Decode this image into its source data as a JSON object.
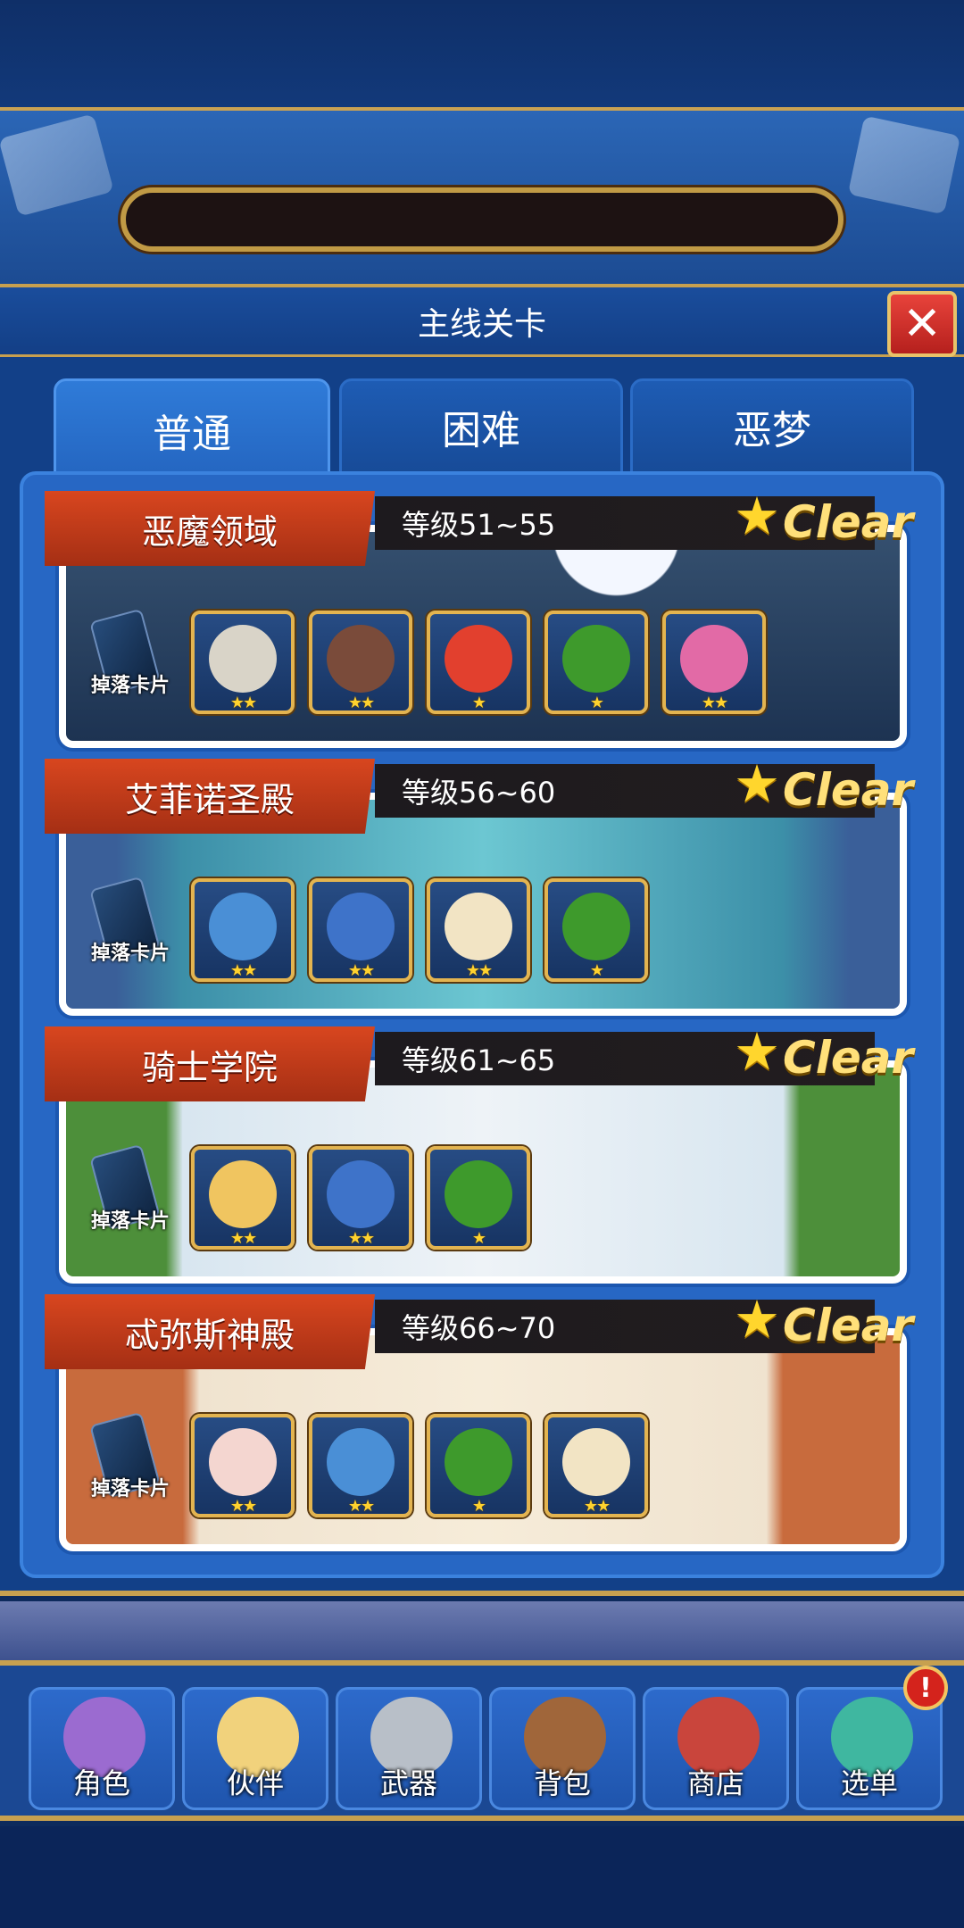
{
  "window": {
    "title": "主线关卡",
    "close_symbol": "✕"
  },
  "tabs": [
    {
      "label": "普通",
      "active": true
    },
    {
      "label": "困难",
      "active": false
    },
    {
      "label": "恶梦",
      "active": false
    }
  ],
  "drop_label": "掉落卡片",
  "clear_label": "Clear",
  "stages": [
    {
      "name": "恶魔领域",
      "level": "等级51~55",
      "enemies": [
        {
          "icon": "skeleton-shield-icon",
          "stars": "★★",
          "color": "#d9d4c8"
        },
        {
          "icon": "hooded-monk-icon",
          "stars": "★★",
          "color": "#7a4b3a"
        },
        {
          "icon": "red-cat-imp-icon",
          "stars": "★",
          "color": "#e2402e"
        },
        {
          "icon": "green-hood-icon",
          "stars": "★",
          "color": "#3e9a2c"
        },
        {
          "icon": "pink-succubus-icon",
          "stars": "★★",
          "color": "#e26aa6"
        }
      ]
    },
    {
      "name": "艾菲诺圣殿",
      "level": "等级56~60",
      "enemies": [
        {
          "icon": "blue-cap-boy-icon",
          "stars": "★★",
          "color": "#4a8fd6"
        },
        {
          "icon": "blue-knight-icon",
          "stars": "★★",
          "color": "#3e73c9"
        },
        {
          "icon": "unicorn-icon",
          "stars": "★★",
          "color": "#f2e4c4"
        },
        {
          "icon": "green-hood-icon",
          "stars": "★",
          "color": "#3e9a2c"
        }
      ]
    },
    {
      "name": "骑士学院",
      "level": "等级61~65",
      "enemies": [
        {
          "icon": "blonde-girl-icon",
          "stars": "★★",
          "color": "#f0c560"
        },
        {
          "icon": "blue-knight-icon",
          "stars": "★★",
          "color": "#3e73c9"
        },
        {
          "icon": "green-hood-icon",
          "stars": "★",
          "color": "#3e9a2c"
        }
      ]
    },
    {
      "name": "忒弥斯神殿",
      "level": "等级66~70",
      "enemies": [
        {
          "icon": "owl-icon",
          "stars": "★★",
          "color": "#f4d6d0"
        },
        {
          "icon": "blue-cap-boy-icon",
          "stars": "★★",
          "color": "#4a8fd6"
        },
        {
          "icon": "green-hood-icon",
          "stars": "★",
          "color": "#3e9a2c"
        },
        {
          "icon": "unicorn-icon",
          "stars": "★★",
          "color": "#f2e4c4"
        }
      ]
    }
  ],
  "nav": [
    {
      "label": "角色",
      "icon": "purple-hair-girl-icon",
      "color": "#9b6bd0"
    },
    {
      "label": "伙伴",
      "icon": "fairy-icon",
      "color": "#f1d27c"
    },
    {
      "label": "武器",
      "icon": "sword-icon",
      "color": "#b8bfc8"
    },
    {
      "label": "背包",
      "icon": "backpack-icon",
      "color": "#a0663a"
    },
    {
      "label": "商店",
      "icon": "shop-icon",
      "color": "#c9453c"
    },
    {
      "label": "选单",
      "icon": "grid-menu-icon",
      "color": "#3fb7a0"
    }
  ],
  "menu_badge": "!"
}
